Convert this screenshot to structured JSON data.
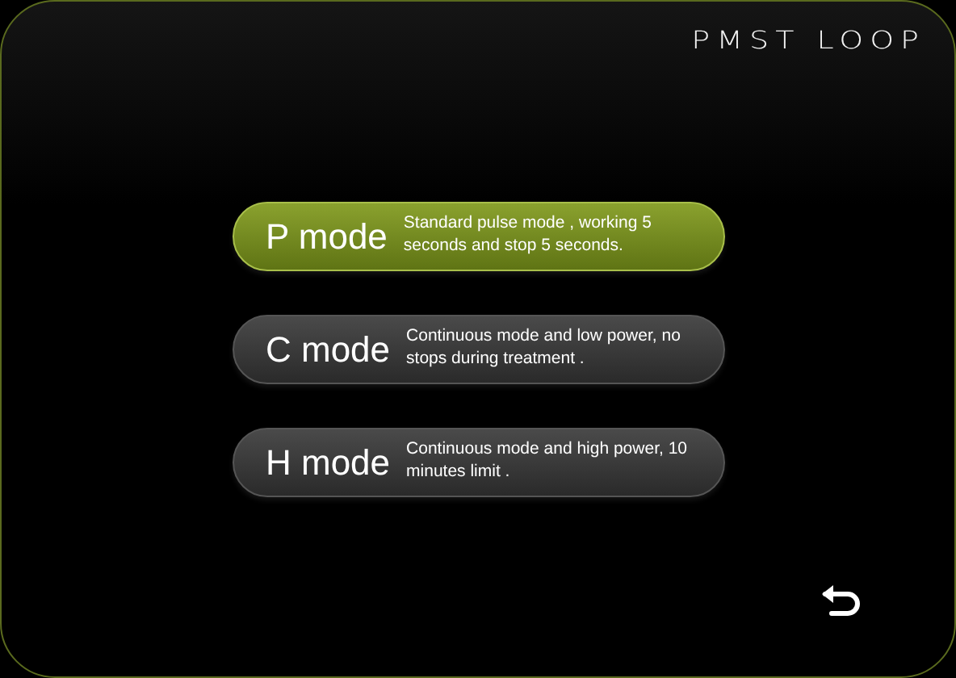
{
  "title": "PMST LOOP",
  "modes": [
    {
      "name": "P mode",
      "description": "Standard pulse mode , working 5 seconds and stop 5 seconds.",
      "selected": true
    },
    {
      "name": "C mode",
      "description": "Continuous mode and low power, no stops during treatment .",
      "selected": false
    },
    {
      "name": "H mode",
      "description": "Continuous mode and high power, 10 minutes limit .",
      "selected": false
    }
  ]
}
